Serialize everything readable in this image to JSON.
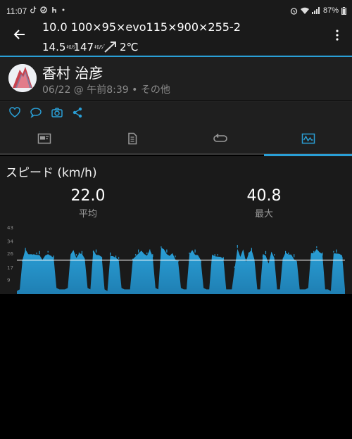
{
  "status_bar": {
    "time": "11:07",
    "notifications": [
      "tiktok-icon",
      "sync-icon",
      "vpn-icon",
      "dot"
    ],
    "battery": "87%"
  },
  "header": {
    "title": "10.0 100×95×evo115×900×255-2",
    "speed_value": "14.5",
    "speed_unit": "ｷﾛ/ｼﾞ",
    "second_value": "147",
    "second_unit": "ｷﾛ/ｼﾞ",
    "temperature": "2℃"
  },
  "profile": {
    "name": "香村 治彦",
    "meta": "06/22 @ 午前8:39 • その他"
  },
  "actions": [
    "heart-icon",
    "comment-icon",
    "camera-icon",
    "share-icon"
  ],
  "tabs": [
    {
      "name": "tab-overview",
      "icon": "summary-icon"
    },
    {
      "name": "tab-details",
      "icon": "document-icon"
    },
    {
      "name": "tab-laps",
      "icon": "laps-icon"
    },
    {
      "name": "tab-charts",
      "icon": "chart-icon",
      "active": true
    }
  ],
  "content": {
    "heading": "スピード (km/h)",
    "average": {
      "value": "22.0",
      "label": "平均"
    },
    "max": {
      "value": "40.8",
      "label": "最大"
    }
  },
  "chart_data": {
    "type": "area",
    "y_ticks": [
      "43",
      "34",
      "26",
      "17",
      "9"
    ],
    "ylim": [
      0,
      43
    ],
    "average_line": 22.0,
    "color": "#2a9fd6",
    "series": [
      {
        "values": [
          2,
          3,
          22,
          28,
          27,
          26,
          25,
          27,
          26,
          22,
          24,
          27,
          25,
          23,
          4,
          3,
          3,
          3,
          4,
          26,
          28,
          25,
          27,
          26,
          22,
          4,
          3,
          28,
          27,
          26,
          24,
          3,
          2,
          25,
          24,
          25,
          23,
          4,
          3,
          3,
          3,
          22,
          26,
          27,
          28,
          25,
          26,
          29,
          24,
          4,
          3,
          30,
          28,
          27,
          25,
          26,
          24,
          22,
          4,
          3,
          3,
          26,
          28,
          27,
          26,
          22,
          4,
          3,
          3,
          25,
          26,
          25,
          24,
          22,
          3,
          3,
          3,
          18,
          30,
          24,
          28,
          22,
          27,
          28,
          24,
          3,
          3,
          25,
          26,
          20,
          27,
          25,
          3,
          3,
          22,
          28,
          26,
          25,
          24,
          22,
          3,
          3,
          3,
          4,
          26,
          28,
          30,
          27,
          25,
          3,
          3,
          2,
          28,
          27,
          26,
          24,
          3
        ]
      }
    ]
  }
}
